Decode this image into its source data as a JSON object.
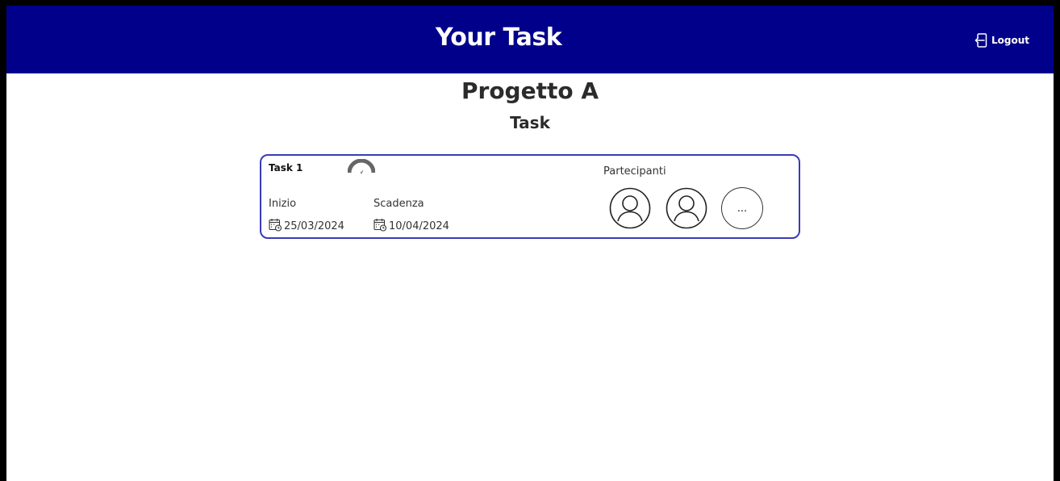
{
  "header": {
    "title": "Your Task",
    "logout_label": "Logout",
    "logout_icon": "logout-icon",
    "background_color": "#00008b"
  },
  "project": {
    "title": "Progetto A",
    "section_title": "Task"
  },
  "task_card": {
    "name": "Task 1",
    "progress_icon": "gauge-icon",
    "start_label": "Inizio",
    "start_date": "25/03/2024",
    "due_label": "Scadenza",
    "due_date": "10/04/2024",
    "date_icon": "calendar-clock-icon",
    "participants_label": "Partecipanti",
    "participants": [
      {
        "icon": "user-avatar-icon"
      },
      {
        "icon": "user-avatar-icon"
      }
    ],
    "more_label": "...",
    "border_color": "#3b3bb5"
  }
}
